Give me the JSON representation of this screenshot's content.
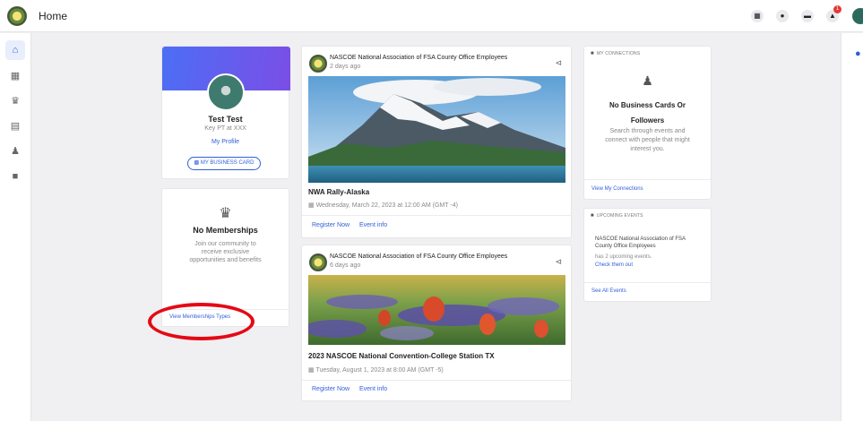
{
  "header": {
    "title": "Home",
    "icons": [
      "grid-icon",
      "bulb-icon",
      "chat-icon",
      "bell-icon"
    ],
    "notification_count": "1"
  },
  "sidebar": {
    "items": [
      "home-icon",
      "calendar-icon",
      "crown-icon",
      "inbox-icon",
      "people-icon",
      "briefcase-icon"
    ]
  },
  "profile": {
    "name": "Test Test",
    "title": "Key PT at XXX",
    "profile_link": "My Profile",
    "business_card_button": "MY BUSINESS CARD"
  },
  "memberships": {
    "title": "No Memberships",
    "description": "Join our community to receive exclusive opportunities and benefits",
    "link": "View Memberships Types"
  },
  "posts": [
    {
      "org": "NASCOE National Association of FSA County Office Employees",
      "time": "2 days ago",
      "title": "NWA Rally-Alaska",
      "date": "Wednesday, March 22, 2023 at 12:00 AM (GMT -4)",
      "register": "Register Now",
      "info": "Event info"
    },
    {
      "org": "NASCOE National Association of FSA County Office Employees",
      "time": "6 days ago",
      "title": "2023 NASCOE National Convention-College Station TX",
      "date": "Tuesday, August 1, 2023 at 8:00 AM (GMT -5)",
      "register": "Register Now",
      "info": "Event info"
    }
  ],
  "connections": {
    "header": "MY CONNECTIONS",
    "title": "No Business Cards Or Followers",
    "description": "Search through events and connect with people that might interest you.",
    "link": "View My Connections"
  },
  "upcoming_events": {
    "header": "UPCOMING EVENTS",
    "org": "NASCOE National Association of FSA County Office Employees",
    "count_text": "has 2 upcoming events.",
    "check_link": "Check them out",
    "see_all": "See All Events"
  },
  "colors": {
    "accent": "#2f5fd8",
    "highlight_circle": "#e50914",
    "badge": "#e53935"
  }
}
